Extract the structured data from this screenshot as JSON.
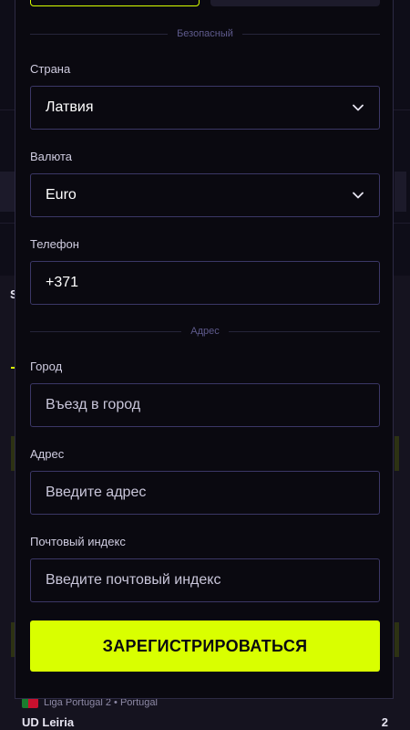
{
  "background": {
    "section_initial": "S",
    "match": {
      "league": "Liga Portugal 2 • Portugal",
      "team": "UD Leiria",
      "score": "2"
    }
  },
  "form": {
    "divider_security": "Безопасный",
    "country": {
      "label": "Страна",
      "value": "Латвия"
    },
    "currency": {
      "label": "Валюта",
      "value": "Euro"
    },
    "phone": {
      "label": "Телефон",
      "value": "+371"
    },
    "divider_address": "Адрес",
    "city": {
      "label": "Город",
      "placeholder": "Въезд в город"
    },
    "address": {
      "label": "Адрес",
      "placeholder": "Введите адрес"
    },
    "postal": {
      "label": "Почтовый индекс",
      "placeholder": "Введите почтовый индекс"
    },
    "submit_label": "ЗАРЕГИСТРИРОВАТЬСЯ"
  },
  "colors": {
    "accent": "#d9ff00",
    "field_border": "#3b3766",
    "modal_bg": "#0a0910"
  },
  "icons": [
    "chevron-down-icon",
    "portugal-flag-icon"
  ]
}
